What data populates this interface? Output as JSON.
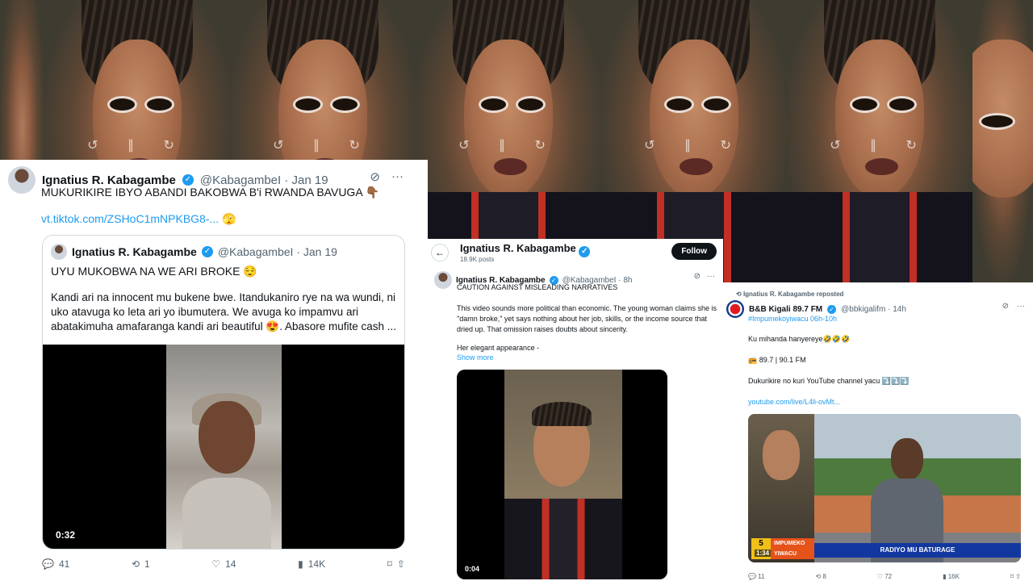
{
  "video_frames": [
    {
      "controls": "↺ ∥ ↻"
    },
    {
      "controls": "↺ ∥ ↻"
    },
    {
      "controls": "↺ ∥ ↻"
    },
    {
      "controls": "↺ ∥ ↻"
    },
    {
      "controls": "↺ ∥ ↻"
    }
  ],
  "tweet1": {
    "author": "Ignatius R. Kabagambe",
    "handle": "@KabagambeI · Jan 19",
    "text": "MUKURIKIRE IBYO ABANDI BAKOBWA B'i RWANDA BAVUGA 👇🏾",
    "link": "vt.tiktok.com/ZSHoC1mNPKBG8-... 🫣",
    "quote": {
      "author": "Ignatius R. Kabagambe",
      "handle": "@KabagambeI · Jan 19",
      "line1": "UYU MUKOBWA NA WE ARI BROKE 😌",
      "body": "Kandi ari na innocent mu bukene bwe. Itandukaniro rye na wa wundi, ni uko atavuga ko leta ari yo ibumutera. We avuga ko impamvu ari abatakimuha amafaranga kandi ari beautiful 😍. Abasore mufite cash ...",
      "video_time": "0:32"
    },
    "actions": {
      "replies": "41",
      "reposts": "1",
      "likes": "14",
      "views": "14K"
    }
  },
  "tweet2": {
    "profile_name": "Ignatius R. Kabagambe",
    "post_count": "18.9K posts",
    "follow_label": "Follow",
    "author": "Ignatius R. Kabagambe",
    "handle": "@KabagambeI · 8h",
    "line1": "CAUTION AGAINST MISLEADING NARRATIVES",
    "body": "This video sounds more political than economic. The young woman claims she is \"damn broke,\" yet says nothing about her job, skills, or the income source that dried up. That omission raises doubts about sincerity.",
    "appearance": "Her elegant appearance -",
    "show_more": "Show more",
    "video_time": "0:04"
  },
  "tweet3": {
    "repost_line": "Ignatius R. Kabagambe reposted",
    "author": "B&B Kigali 89.7 FM",
    "handle": "@bbkigalifm · 14h",
    "hashtag": "#Impumekoyiwacu 06h-10h",
    "p1": "Ku mihanda hanyereye🤣🤣🤣",
    "p2": "📻 89.7 | 90.1 FM",
    "p3": "Dukurikire no kuri YouTube channel yacu ⤵️⤵️⤵️",
    "p4": "youtube.com/live/L4li-ovMt...",
    "media": {
      "banner": "RADIYO MU BATURAGE",
      "tag_line1": "IMPUMEKO",
      "tag_line2": "YIWACU",
      "channel": "5",
      "time": "1:34"
    },
    "actions": {
      "replies": "11",
      "reposts": "8",
      "likes": "72",
      "views": "16K"
    }
  }
}
